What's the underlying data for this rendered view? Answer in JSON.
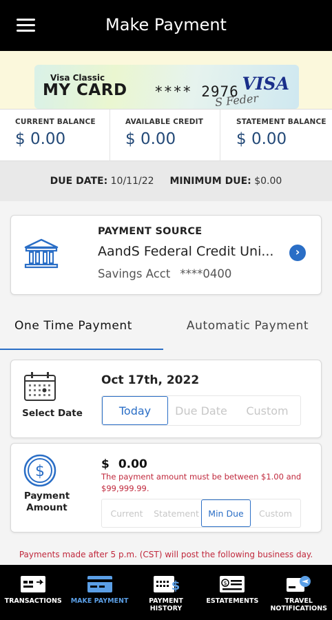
{
  "header": {
    "title": "Make Payment"
  },
  "card": {
    "type_label": "Visa Classic",
    "name": "MY CARD",
    "number_masked": "**** 2976",
    "network": "VISA",
    "signature_text": "S Feder"
  },
  "balances": [
    {
      "label": "CURRENT BALANCE",
      "amount": "$ 0.00"
    },
    {
      "label": "AVAILABLE CREDIT",
      "amount": "$ 0.00"
    },
    {
      "label": "STATEMENT BALANCE",
      "amount": "$ 0.00"
    }
  ],
  "due": {
    "due_date_label": "DUE DATE:",
    "due_date_value": "10/11/22",
    "minimum_due_label": "MINIMUM DUE:",
    "minimum_due_value": "$0.00"
  },
  "payment_source": {
    "title": "PAYMENT SOURCE",
    "institution": "AandS Federal Credit Uni...",
    "account_type": "Savings Acct",
    "account_number": "****0400"
  },
  "tabs": [
    {
      "label": "One Time Payment",
      "active": true
    },
    {
      "label": "Automatic Payment",
      "active": false
    }
  ],
  "select_date": {
    "label": "Select Date",
    "value": "Oct 17th, 2022",
    "options": [
      "Today",
      "Due Date",
      "Custom"
    ],
    "selected": "Today"
  },
  "payment_amount": {
    "label": "Payment Amount",
    "currency": "$",
    "value": "0.00",
    "error": "The payment amount must be between $1.00 and $99,999.99.",
    "options": [
      "Current",
      "Statement",
      "Min Due",
      "Custom"
    ],
    "selected": "Min Due"
  },
  "footnote": "Payments made after 5 p.m. (CST) will post the following business day.",
  "bottom_nav": [
    {
      "label": "TRANSACTIONS",
      "icon": "transactions-icon",
      "active": false
    },
    {
      "label": "MAKE PAYMENT",
      "icon": "make-payment-icon",
      "active": true
    },
    {
      "label": "PAYMENT HISTORY",
      "icon": "payment-history-icon",
      "active": false
    },
    {
      "label": "eSTATEMENTS",
      "icon": "estatements-icon",
      "active": false
    },
    {
      "label": "TRAVEL NOTIFICATIONS",
      "icon": "travel-notifications-icon",
      "active": false
    }
  ],
  "colors": {
    "accent": "#2a6ec6",
    "error": "#c0283c",
    "header_bg": "#000000",
    "amount_text": "#244a78"
  }
}
